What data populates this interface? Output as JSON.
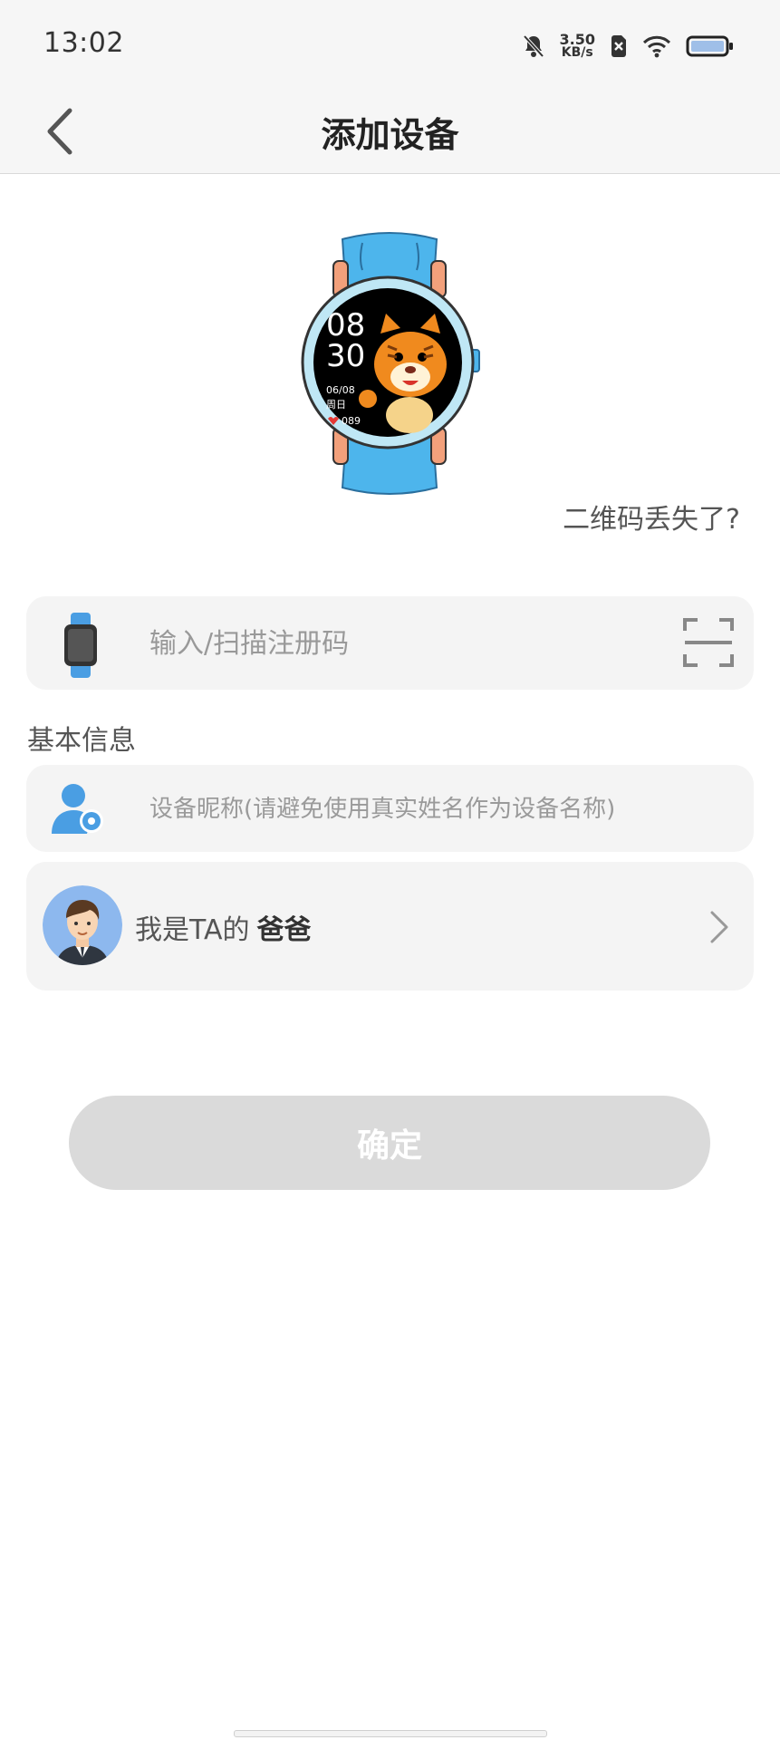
{
  "status_bar": {
    "time": "13:02",
    "net_speed_value": "3.50",
    "net_speed_unit": "KB/s",
    "icons": [
      "bell-off-icon",
      "sim-off-icon",
      "wifi-icon",
      "battery-icon"
    ]
  },
  "nav": {
    "title": "添加设备",
    "back_icon": "chevron-left-icon"
  },
  "illustration": {
    "time_hour": "08",
    "time_min": "30",
    "date": "06/08",
    "weekday": "周日",
    "heart_rate": "089"
  },
  "lost_qr_link": "二维码丢失了?",
  "register": {
    "placeholder": "输入/扫描注册码",
    "value": "",
    "scan_icon": "scan-icon"
  },
  "basic_info": {
    "title": "基本信息",
    "nickname_placeholder": "设备昵称(请避免使用真实姓名作为设备名称)",
    "nickname_value": ""
  },
  "relation": {
    "prefix": "我是TA的",
    "role": "爸爸"
  },
  "confirm_label": "确定",
  "colors": {
    "accent_blue": "#4a9ee3",
    "card_bg": "#f4f4f4",
    "disabled_button": "#dadada",
    "header_bg": "#f6f6f6"
  }
}
